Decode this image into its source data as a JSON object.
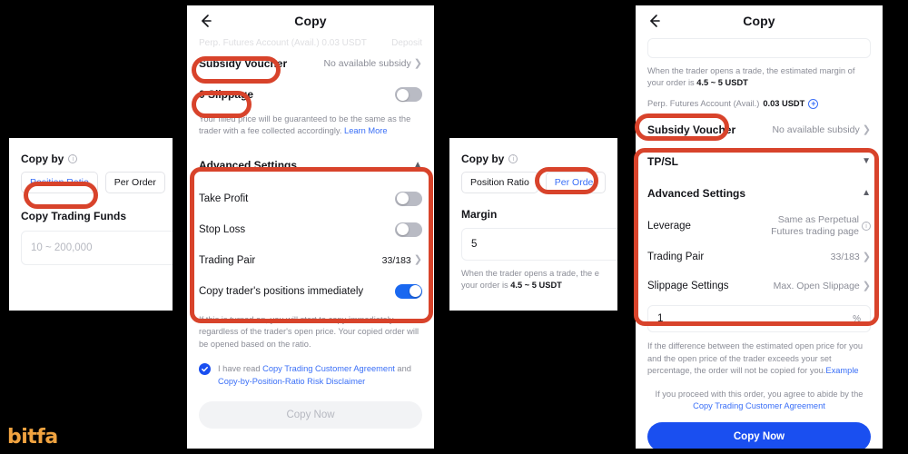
{
  "watermark": "bitfa",
  "panel1": {
    "copy_by_label": "Copy by",
    "segments": [
      {
        "label": "Position Ratio",
        "active": true
      },
      {
        "label": "Per Order",
        "active": false
      }
    ],
    "funds_title": "Copy Trading Funds",
    "funds_placeholder": "10 ~ 200,000"
  },
  "panel2": {
    "header_title": "Copy",
    "clipped_row": {
      "label": "Perp. Futures Account (Avail.) 0.03 USDT",
      "value": "Deposit"
    },
    "subsidy": {
      "label": "Subsidy Voucher",
      "value": "No available subsidy"
    },
    "slippage": {
      "label": "0 Slippage",
      "toggle": "off"
    },
    "slippage_note_1": "Your filled price will be guaranteed to be the same as the",
    "slippage_note_2": "trader with a fee collected accordingly. ",
    "slippage_note_link": "Learn More",
    "advanced_title": "Advanced Settings",
    "rows": [
      {
        "label": "Take Profit",
        "type": "toggle",
        "toggle": "off"
      },
      {
        "label": "Stop Loss",
        "type": "toggle",
        "toggle": "off"
      },
      {
        "label": "Trading Pair",
        "type": "value",
        "value": "33/183"
      },
      {
        "label": "Copy trader's positions immediately",
        "type": "toggle",
        "toggle": "on"
      }
    ],
    "immediate_note": "If this is turned on, you will start to copy immediately regardless of the trader's open price. Your copied order will be opened based on the ratio.",
    "agreement_prefix": "I have read ",
    "agreement_link_1": "Copy Trading Customer Agreement",
    "agreement_middle": " and ",
    "agreement_link_2": "Copy-by-Position-Ratio Risk Disclaimer",
    "cta_label": "Copy Now"
  },
  "panel3": {
    "copy_by_label": "Copy by",
    "segments": [
      {
        "label": "Position Ratio",
        "active": false
      },
      {
        "label": "Per Order",
        "active": true
      }
    ],
    "margin_title": "Margin",
    "margin_value": "5",
    "margin_note_1": "When the trader opens a trade, the e",
    "margin_note_2": "your order is ",
    "margin_note_strong": "4.5 ~ 5 USDT"
  },
  "panel4": {
    "header_title": "Copy",
    "margin_note_1": "When the trader opens a trade, the estimated margin of",
    "margin_note_2": "your order is ",
    "margin_note_strong": "4.5 ~ 5 USDT",
    "account_label": "Perp. Futures Account (Avail.) ",
    "account_value": "0.03 USDT",
    "subsidy": {
      "label": "Subsidy Voucher",
      "value": "No available subsidy"
    },
    "tpsl_label": "TP/SL",
    "advanced_title": "Advanced Settings",
    "rows": [
      {
        "label": "Leverage",
        "value": "Same as Perpetual\nFutures trading page",
        "info": true
      },
      {
        "label": "Trading Pair",
        "value": "33/183",
        "chevron": true
      },
      {
        "label": "Slippage Settings",
        "value": "Max. Open Slippage",
        "chevron": true
      }
    ],
    "slippage_value": "1",
    "slippage_unit": "%",
    "slippage_note": "If the difference between the estimated open price for you and the open price of the trader exceeds your set percentage, the order will not be copied for you.",
    "slippage_note_link": "Example",
    "agree_note": "If you proceed with this order, you agree to abide by the",
    "agree_link": "Copy Trading Customer Agreement",
    "cta_label": "Copy Now"
  },
  "colors": {
    "annotation_red": "#d8432b",
    "accent_blue": "#1a4ff0",
    "link_blue": "#3a6ff7",
    "toggle_on": "#1a68f0",
    "watermark_orange": "#f0a340"
  }
}
